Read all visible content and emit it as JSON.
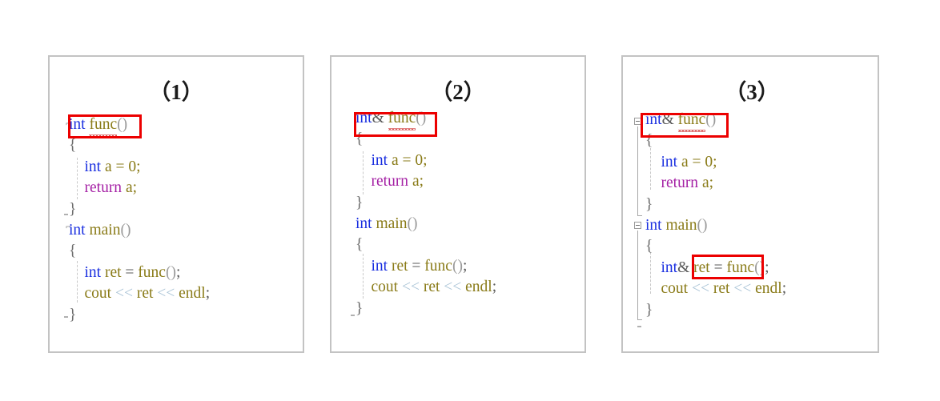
{
  "page": {
    "background": "#ffffff",
    "panel_border_color": "#c3c3c3",
    "highlight_color": "#ec0000"
  },
  "syntax_colors": {
    "keyword": "#1a2fe0",
    "return_keyword": "#a521a5",
    "identifier": "#8a7b18",
    "punctuation": "#9a9a9a",
    "operator": "#5a5a5a",
    "shift_operator": "#a9c3d6"
  },
  "panels": [
    {
      "id": "panel-1",
      "title": "（1）",
      "code_lines": [
        {
          "tokens": [
            {
              "t": "int",
              "c": "kw"
            },
            {
              "t": " ",
              "c": "op"
            },
            {
              "t": "func",
              "c": "ident squiggle"
            },
            {
              "t": "()",
              "c": "punct"
            }
          ]
        },
        {
          "tokens": [
            {
              "t": "{",
              "c": "brace"
            }
          ]
        },
        {
          "tokens": [
            {
              "t": "    ",
              "c": "op"
            },
            {
              "t": "int",
              "c": "kw"
            },
            {
              "t": " a = 0;",
              "c": "ident"
            }
          ]
        },
        {
          "tokens": [
            {
              "t": "    ",
              "c": "op"
            },
            {
              "t": "return",
              "c": "ret"
            },
            {
              "t": " a;",
              "c": "ident"
            }
          ]
        },
        {
          "tokens": [
            {
              "t": "}",
              "c": "brace"
            }
          ]
        },
        {
          "tokens": [
            {
              "t": "int",
              "c": "kw"
            },
            {
              "t": " ",
              "c": "op"
            },
            {
              "t": "main",
              "c": "ident"
            },
            {
              "t": "()",
              "c": "punct"
            }
          ]
        },
        {
          "tokens": [
            {
              "t": "{",
              "c": "brace"
            }
          ]
        },
        {
          "tokens": [
            {
              "t": "    ",
              "c": "op"
            },
            {
              "t": "int",
              "c": "kw"
            },
            {
              "t": " ret",
              "c": "ident"
            },
            {
              "t": " = ",
              "c": "op"
            },
            {
              "t": "func",
              "c": "ident"
            },
            {
              "t": "()",
              "c": "punct"
            },
            {
              "t": ";",
              "c": "op"
            }
          ]
        },
        {
          "tokens": [
            {
              "t": "    ",
              "c": "op"
            },
            {
              "t": "cout",
              "c": "ident"
            },
            {
              "t": " << ",
              "c": "shift"
            },
            {
              "t": "ret",
              "c": "ident"
            },
            {
              "t": " << ",
              "c": "shift"
            },
            {
              "t": "endl",
              "c": "ident"
            },
            {
              "t": ";",
              "c": "op"
            }
          ]
        },
        {
          "tokens": [
            {
              "t": "}",
              "c": "brace"
            }
          ]
        }
      ],
      "highlight_label": "int func",
      "gutter_style": "dashed"
    },
    {
      "id": "panel-2",
      "title": "（2）",
      "code_lines": [
        {
          "tokens": [
            {
              "t": "int",
              "c": "kw"
            },
            {
              "t": "&",
              "c": "op"
            },
            {
              "t": " ",
              "c": "op"
            },
            {
              "t": "func",
              "c": "ident squiggle"
            },
            {
              "t": "()",
              "c": "punct"
            }
          ]
        },
        {
          "tokens": [
            {
              "t": "{",
              "c": "brace"
            }
          ]
        },
        {
          "tokens": [
            {
              "t": "    ",
              "c": "op"
            },
            {
              "t": "int",
              "c": "kw"
            },
            {
              "t": " a = 0;",
              "c": "ident"
            }
          ]
        },
        {
          "tokens": [
            {
              "t": "    ",
              "c": "op"
            },
            {
              "t": "return",
              "c": "ret"
            },
            {
              "t": " a;",
              "c": "ident"
            }
          ]
        },
        {
          "tokens": [
            {
              "t": "}",
              "c": "brace"
            }
          ]
        },
        {
          "tokens": [
            {
              "t": "int",
              "c": "kw"
            },
            {
              "t": " ",
              "c": "op"
            },
            {
              "t": "main",
              "c": "ident"
            },
            {
              "t": "()",
              "c": "punct"
            }
          ]
        },
        {
          "tokens": [
            {
              "t": "{",
              "c": "brace"
            }
          ]
        },
        {
          "tokens": [
            {
              "t": "    ",
              "c": "op"
            },
            {
              "t": "int",
              "c": "kw"
            },
            {
              "t": " ret",
              "c": "ident"
            },
            {
              "t": " = ",
              "c": "op"
            },
            {
              "t": "func",
              "c": "ident"
            },
            {
              "t": "()",
              "c": "punct"
            },
            {
              "t": ";",
              "c": "op"
            }
          ]
        },
        {
          "tokens": [
            {
              "t": "    ",
              "c": "op"
            },
            {
              "t": "cout",
              "c": "ident"
            },
            {
              "t": " << ",
              "c": "shift"
            },
            {
              "t": "ret",
              "c": "ident"
            },
            {
              "t": " << ",
              "c": "shift"
            },
            {
              "t": "endl",
              "c": "ident"
            },
            {
              "t": ";",
              "c": "op"
            }
          ]
        },
        {
          "tokens": [
            {
              "t": "}",
              "c": "brace"
            }
          ]
        }
      ],
      "highlight_label": "int& func",
      "gutter_style": "dashed"
    },
    {
      "id": "panel-3",
      "title": "（3）",
      "code_lines": [
        {
          "tokens": [
            {
              "t": "int",
              "c": "kw"
            },
            {
              "t": "&",
              "c": "op"
            },
            {
              "t": " ",
              "c": "op"
            },
            {
              "t": "func",
              "c": "ident squiggle"
            },
            {
              "t": "()",
              "c": "punct"
            }
          ]
        },
        {
          "tokens": [
            {
              "t": "{",
              "c": "brace"
            }
          ]
        },
        {
          "tokens": [
            {
              "t": "    ",
              "c": "op"
            },
            {
              "t": "int",
              "c": "kw"
            },
            {
              "t": " a = 0;",
              "c": "ident"
            }
          ]
        },
        {
          "tokens": [
            {
              "t": "    ",
              "c": "op"
            },
            {
              "t": "return",
              "c": "ret"
            },
            {
              "t": " a;",
              "c": "ident"
            }
          ]
        },
        {
          "tokens": [
            {
              "t": "}",
              "c": "brace"
            }
          ]
        },
        {
          "tokens": [
            {
              "t": "int",
              "c": "kw"
            },
            {
              "t": " ",
              "c": "op"
            },
            {
              "t": "main",
              "c": "ident"
            },
            {
              "t": "()",
              "c": "punct"
            }
          ]
        },
        {
          "tokens": [
            {
              "t": "{",
              "c": "brace"
            }
          ]
        },
        {
          "tokens": [
            {
              "t": "    ",
              "c": "op"
            },
            {
              "t": "int",
              "c": "kw"
            },
            {
              "t": "&",
              "c": "op"
            },
            {
              "t": " ret",
              "c": "ident"
            },
            {
              "t": " = ",
              "c": "op"
            },
            {
              "t": "func",
              "c": "ident"
            },
            {
              "t": "()",
              "c": "punct"
            },
            {
              "t": ";",
              "c": "op"
            }
          ]
        },
        {
          "tokens": [
            {
              "t": "    ",
              "c": "op"
            },
            {
              "t": "cout",
              "c": "ident"
            },
            {
              "t": " << ",
              "c": "shift"
            },
            {
              "t": "ret",
              "c": "ident"
            },
            {
              "t": " << ",
              "c": "shift"
            },
            {
              "t": "endl",
              "c": "ident"
            },
            {
              "t": ";",
              "c": "op"
            }
          ]
        },
        {
          "tokens": [
            {
              "t": "}",
              "c": "brace"
            }
          ]
        }
      ],
      "highlight_label_1": "int& func",
      "highlight_label_2": "int& ret",
      "gutter_style": "solid"
    }
  ]
}
